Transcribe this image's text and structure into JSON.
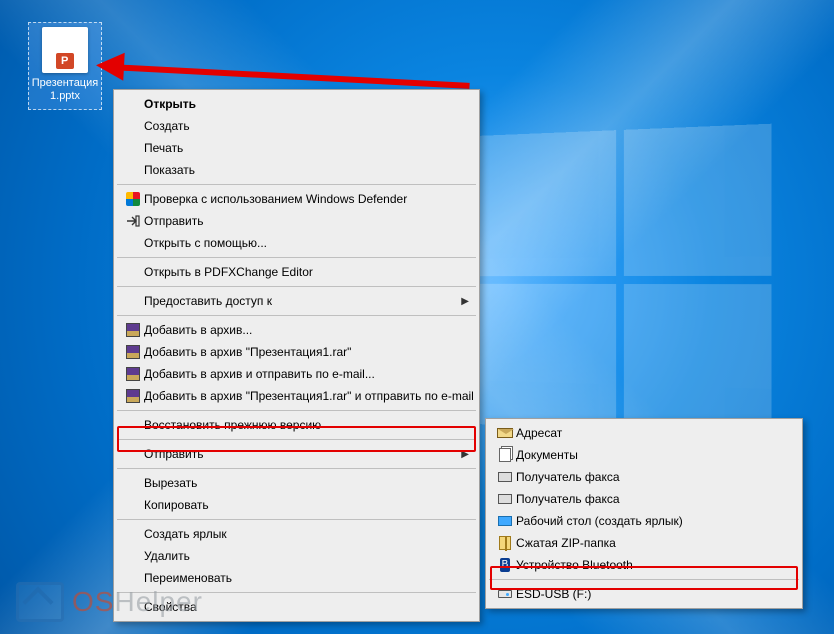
{
  "desktop": {
    "file_label": "Презентация 1.pptx"
  },
  "context_menu": {
    "open": "Открыть",
    "create": "Создать",
    "print": "Печать",
    "show": "Показать",
    "defender": "Проверка с использованием Windows Defender",
    "send_share": "Отправить",
    "open_with": "Открыть с помощью...",
    "pdfx": "Открыть в PDFXChange Editor",
    "grant_access": "Предоставить доступ к",
    "rar_add": "Добавить в архив...",
    "rar_add_named": "Добавить в архив \"Презентация1.rar\"",
    "rar_add_email": "Добавить в архив и отправить по e-mail...",
    "rar_add_named_email": "Добавить в архив \"Презентация1.rar\" и отправить по e-mail",
    "restore": "Восстановить прежнюю версию",
    "send_to": "Отправить",
    "cut": "Вырезать",
    "copy": "Копировать",
    "shortcut": "Создать ярлык",
    "delete": "Удалить",
    "rename": "Переименовать",
    "properties": "Свойства"
  },
  "send_to_menu": {
    "recipient": "Адресат",
    "documents": "Документы",
    "fax1": "Получатель факса",
    "fax2": "Получатель факса",
    "desktop": "Рабочий стол (создать ярлык)",
    "zip": "Сжатая ZIP-папка",
    "bluetooth": "Устройство Bluetooth",
    "drive": "ESD-USB (F:)"
  },
  "watermark": {
    "os": "OS",
    "helper": "Helper"
  }
}
